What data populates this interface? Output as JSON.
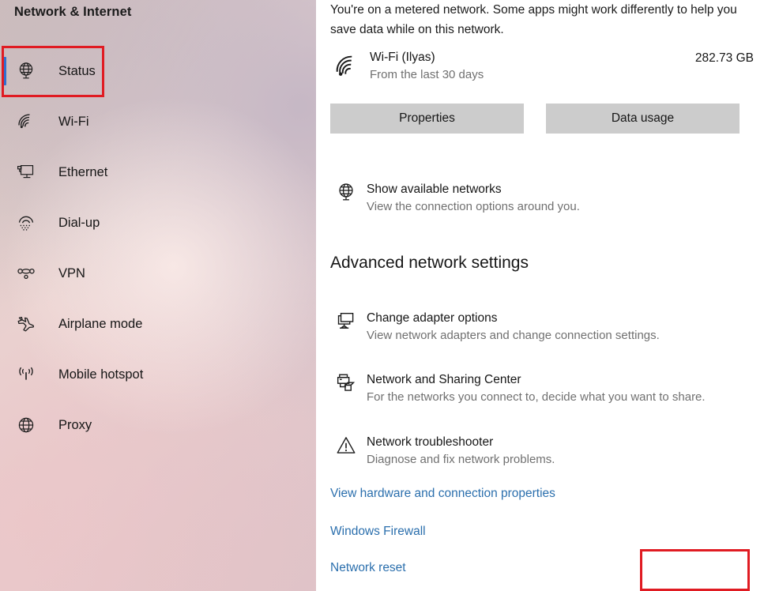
{
  "sidebar": {
    "title": "Network & Internet",
    "items": [
      {
        "label": "Status",
        "icon": "globe-monitor-icon",
        "selected": true
      },
      {
        "label": "Wi-Fi",
        "icon": "wifi-icon",
        "selected": false
      },
      {
        "label": "Ethernet",
        "icon": "ethernet-icon",
        "selected": false
      },
      {
        "label": "Dial-up",
        "icon": "dialup-icon",
        "selected": false
      },
      {
        "label": "VPN",
        "icon": "vpn-icon",
        "selected": false
      },
      {
        "label": "Airplane mode",
        "icon": "airplane-icon",
        "selected": false
      },
      {
        "label": "Mobile hotspot",
        "icon": "hotspot-icon",
        "selected": false
      },
      {
        "label": "Proxy",
        "icon": "globe-icon",
        "selected": false
      }
    ]
  },
  "content": {
    "metered_notice": "You're on a metered network. Some apps might work differently to help you save data while on this network.",
    "connection": {
      "icon": "wifi-icon",
      "name": "Wi-Fi (Ilyas)",
      "subtitle": "From the last 30 days",
      "usage": "282.73 GB"
    },
    "buttons": {
      "properties": "Properties",
      "data_usage": "Data usage"
    },
    "show_networks": {
      "icon": "globe-monitor-icon",
      "title": "Show available networks",
      "subtitle": "View the connection options around you."
    },
    "advanced_heading": "Advanced network settings",
    "advanced_items": [
      {
        "icon": "monitor-icon",
        "title": "Change adapter options",
        "subtitle": "View network adapters and change connection settings."
      },
      {
        "icon": "printer-folder-icon",
        "title": "Network and Sharing Center",
        "subtitle": "For the networks you connect to, decide what you want to share."
      },
      {
        "icon": "warning-triangle-icon",
        "title": "Network troubleshooter",
        "subtitle": "Diagnose and fix network problems."
      }
    ],
    "links": [
      {
        "label": "View hardware and connection properties"
      },
      {
        "label": "Windows Firewall"
      },
      {
        "label": "Network reset",
        "highlighted": true
      }
    ]
  },
  "colors": {
    "highlight_box": "#e01b22",
    "link": "#2b6fad",
    "selection_bar": "#2f6fd0",
    "button_bg": "#cccccc",
    "sidebar_bg": "#ddc6c7",
    "content_bg": "#ffffff"
  }
}
